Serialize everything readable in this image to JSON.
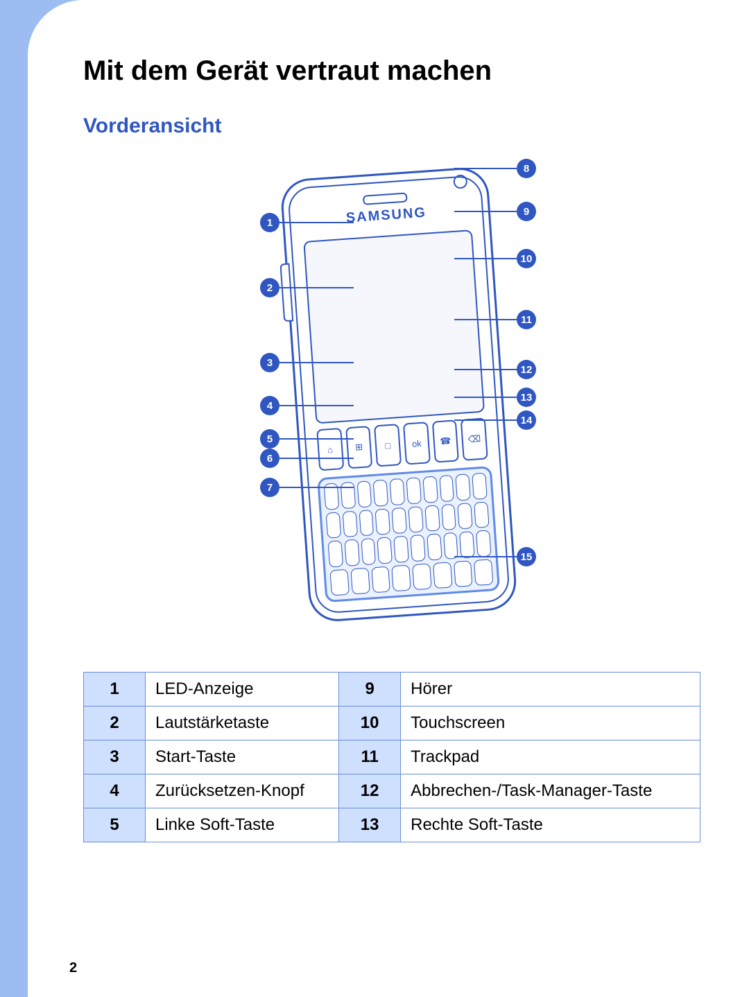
{
  "title": "Mit dem Gerät vertraut machen",
  "section": "Vorderansicht",
  "brand": "SAMSUNG",
  "page_number": "2",
  "buttons_row": [
    "⌂",
    "⊞",
    "□",
    "ok",
    "☎",
    "⌫"
  ],
  "callouts_left": [
    {
      "n": "1",
      "top": "78"
    },
    {
      "n": "2",
      "top": "172"
    },
    {
      "n": "3",
      "top": "280"
    },
    {
      "n": "4",
      "top": "342"
    },
    {
      "n": "5",
      "top": "390"
    },
    {
      "n": "6",
      "top": "418"
    },
    {
      "n": "7",
      "top": "460"
    }
  ],
  "callouts_right": [
    {
      "n": "8",
      "top": "0"
    },
    {
      "n": "9",
      "top": "62"
    },
    {
      "n": "10",
      "top": "130"
    },
    {
      "n": "11",
      "top": "218"
    },
    {
      "n": "12",
      "top": "290"
    },
    {
      "n": "13",
      "top": "330"
    },
    {
      "n": "14",
      "top": "363"
    },
    {
      "n": "15",
      "top": "560"
    }
  ],
  "legend_rows": [
    {
      "a": "1",
      "al": "LED-Anzeige",
      "b": "9",
      "bl": "Hörer"
    },
    {
      "a": "2",
      "al": "Lautstärketaste",
      "b": "10",
      "bl": "Touchscreen"
    },
    {
      "a": "3",
      "al": "Start-Taste",
      "b": "11",
      "bl": "Trackpad"
    },
    {
      "a": "4",
      "al": "Zurücksetzen-Knopf",
      "b": "12",
      "bl": "Abbrechen-/Task-Manager-Taste"
    },
    {
      "a": "5",
      "al": "Linke Soft-Taste",
      "b": "13",
      "bl": "Rechte Soft-Taste"
    }
  ]
}
